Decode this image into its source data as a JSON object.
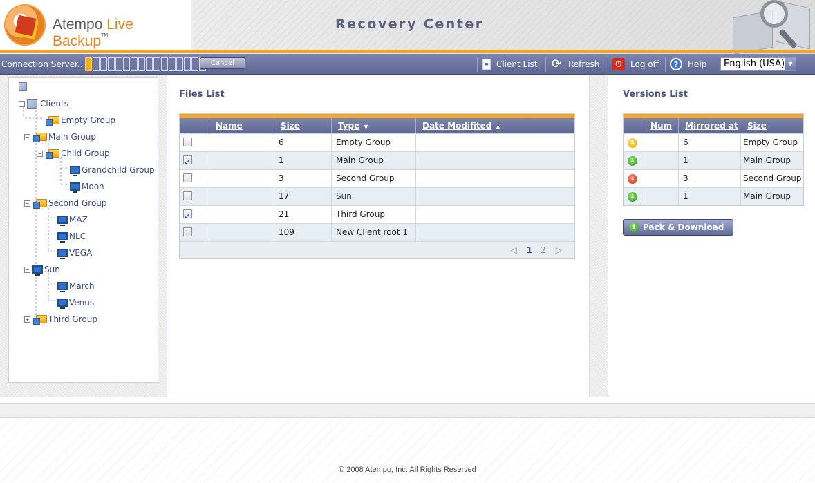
{
  "header": {
    "brand_name": "Atempo",
    "brand_product": "Live Backup",
    "brand_tm": "TM",
    "title": "Recovery Center"
  },
  "toolbar": {
    "connection_label": "Connection Server...",
    "progress": {
      "total_segments": 16,
      "filled_segments": 1
    },
    "cancel_label": "Cancel",
    "client_list_label": "Client List",
    "refresh_label": "Refresh",
    "logoff_label": "Log off",
    "help_label": "Help",
    "language_selected": "English (USA)"
  },
  "tree": {
    "root_label": "Clients",
    "nodes": [
      {
        "label": "Empty Group",
        "type": "folder",
        "expander": ""
      },
      {
        "label": "Main Group",
        "type": "folder",
        "expander": "−"
      },
      {
        "label": "Child Group",
        "type": "folder",
        "expander": "−"
      },
      {
        "label": "Grandchild Group",
        "type": "monitor",
        "expander": ""
      },
      {
        "label": "Moon",
        "type": "monitor",
        "expander": ""
      },
      {
        "label": "Second Group",
        "type": "folder",
        "expander": "−"
      },
      {
        "label": "MAZ",
        "type": "monitor",
        "expander": ""
      },
      {
        "label": "NLC",
        "type": "monitor",
        "expander": ""
      },
      {
        "label": "VEGA",
        "type": "monitor",
        "expander": ""
      },
      {
        "label": "Sun",
        "type": "monitor",
        "expander": "−"
      },
      {
        "label": "March",
        "type": "monitor",
        "expander": ""
      },
      {
        "label": "Venus",
        "type": "monitor",
        "expander": ""
      },
      {
        "label": "Third Group",
        "type": "folder",
        "expander": "+"
      }
    ]
  },
  "files_list": {
    "title": "Files List",
    "columns": [
      "Name",
      "Size",
      "Type",
      "Date Modifited"
    ],
    "rows": [
      {
        "checked": false,
        "name": "",
        "size": "6",
        "type": "Empty Group",
        "date": ""
      },
      {
        "checked": true,
        "name": "",
        "size": "1",
        "type": "Main Group",
        "date": ""
      },
      {
        "checked": false,
        "name": "",
        "size": "3",
        "type": "Second Group",
        "date": ""
      },
      {
        "checked": false,
        "name": "",
        "size": "17",
        "type": "Sun",
        "date": ""
      },
      {
        "checked": true,
        "name": "",
        "size": "21",
        "type": "Third Group",
        "date": ""
      },
      {
        "checked": false,
        "name": "",
        "size": "109",
        "type": "New Client root 1",
        "date": ""
      }
    ],
    "pager": {
      "pages": [
        "1",
        "2"
      ],
      "current": "1"
    }
  },
  "versions_list": {
    "title": "Versions List",
    "columns": [
      "Num",
      "Mirrored at",
      "Size"
    ],
    "rows": [
      {
        "status": "yellow",
        "num": "",
        "mirrored_at": "6",
        "size": "Empty Group"
      },
      {
        "status": "green",
        "num": "",
        "mirrored_at": "1",
        "size": "Main Group"
      },
      {
        "status": "red",
        "num": "",
        "mirrored_at": "3",
        "size": "Second Group"
      },
      {
        "status": "green",
        "num": "",
        "mirrored_at": "1",
        "size": "Main Group"
      }
    ],
    "pack_download_label": "Pack & Download"
  },
  "footer": {
    "copyright": "© 2008 Atempo, Inc. All Rights Reserved"
  },
  "colors": {
    "accent_orange": "#f3a72b",
    "toolbar_blue": "#5d6690",
    "title_text": "#5a5f84"
  }
}
